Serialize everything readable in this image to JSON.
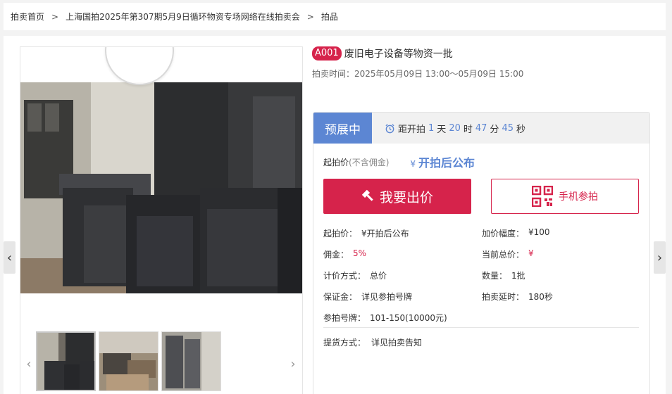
{
  "breadcrumb": {
    "home": "拍卖首页",
    "sep": ">",
    "auction": "上海国拍2025年第307期5月9日循环物资专场网络在线拍卖会",
    "current": "拍品"
  },
  "lot": {
    "number": "A001",
    "title": "废旧电子设备等物资一批",
    "time_label": "拍卖时间：",
    "time_value": "2025年05月09日 13:00～05月09日 15:00"
  },
  "status": {
    "tag": "预展中",
    "countdown_prefix": "距开拍",
    "days": "1",
    "days_unit": "天",
    "hours": "20",
    "hours_unit": "时",
    "minutes": "47",
    "minutes_unit": "分",
    "seconds": "45",
    "seconds_unit": "秒"
  },
  "price": {
    "label": "起拍价",
    "label_sub": "(不含佣金)",
    "currency": "¥",
    "value": "开拍后公布"
  },
  "buttons": {
    "bid": "我要出价",
    "mobile": "手机参拍"
  },
  "info": {
    "start_price_k": "起拍价：",
    "start_price_v": "¥开拍后公布",
    "increment_k": "加价幅度：",
    "increment_v": "¥100",
    "commission_k": "佣金：",
    "commission_v": "5%",
    "current_total_k": "当前总价：",
    "current_total_v": "¥",
    "pricing_k": "计价方式：",
    "pricing_v": "总价",
    "quantity_k": "数量：",
    "quantity_v": "1批",
    "deposit_k": "保证金：",
    "deposit_v": "详见参拍号牌",
    "delay_k": "拍卖延时：",
    "delay_v": "180秒",
    "paddle_k": "参拍号牌：",
    "paddle_v": "101-150(10000元)",
    "pickup_k": "提货方式：",
    "pickup_v": "详见拍卖告知"
  },
  "arrows": {
    "left": "‹",
    "right": "›"
  },
  "colors": {
    "accent_red": "#d6234b",
    "accent_blue": "#5c86d3"
  }
}
